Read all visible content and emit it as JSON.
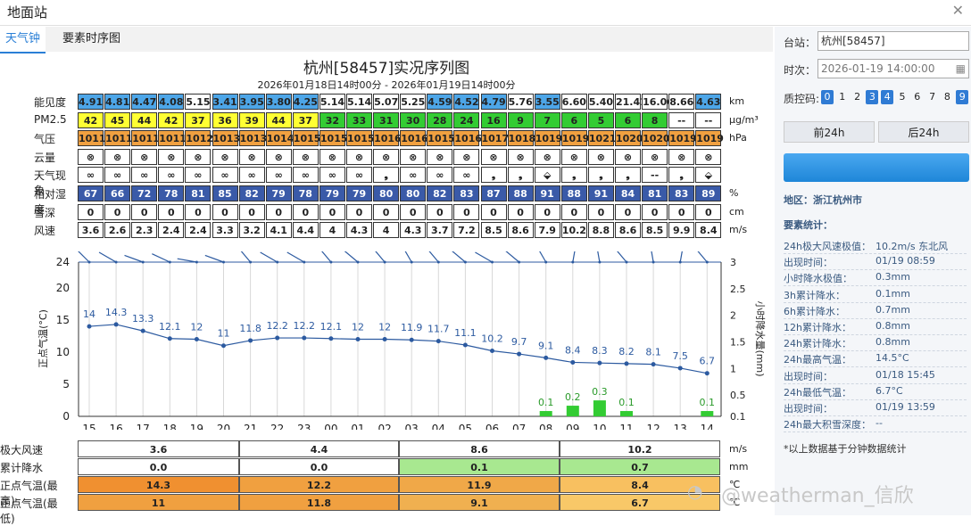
{
  "window": {
    "title": "地面站",
    "close_icon": "close-icon"
  },
  "tabs": [
    {
      "label": "天气钟",
      "active": true
    },
    {
      "label": "要素时序图",
      "active": false
    }
  ],
  "chart": {
    "title": "杭州[58457]实况序列图",
    "subtitle": "2026年01月18日14时00分 - 2026年01月19日14时00分"
  },
  "hours": [
    "15",
    "16",
    "17",
    "18",
    "19",
    "20",
    "21",
    "22",
    "23",
    "00",
    "01",
    "02",
    "03",
    "04",
    "05",
    "06",
    "07",
    "08",
    "09",
    "10",
    "11",
    "12",
    "13",
    "14"
  ],
  "rows": [
    {
      "label": "能见度",
      "unit": "km",
      "values": [
        "4.91",
        "4.81",
        "4.47",
        "4.08",
        "5.15",
        "3.41",
        "3.95",
        "3.80",
        "4.25",
        "5.14",
        "5.14",
        "5.07",
        "5.25",
        "4.59",
        "4.52",
        "4.79",
        "5.76",
        "3.55",
        "6.60",
        "5.40",
        "21.41",
        "16.06",
        "8.66",
        "4.63"
      ],
      "colors": [
        "#4da6e8",
        "#4da6e8",
        "#4da6e8",
        "#4da6e8",
        "#ffffff",
        "#4da6e8",
        "#4da6e8",
        "#4da6e8",
        "#4da6e8",
        "#ffffff",
        "#ffffff",
        "#ffffff",
        "#ffffff",
        "#4da6e8",
        "#4da6e8",
        "#4da6e8",
        "#ffffff",
        "#4da6e8",
        "#ffffff",
        "#ffffff",
        "#ffffff",
        "#ffffff",
        "#ffffff",
        "#4da6e8"
      ]
    },
    {
      "label": "PM2.5",
      "unit": "μg/m³",
      "values": [
        "42",
        "45",
        "44",
        "42",
        "37",
        "36",
        "39",
        "44",
        "37",
        "32",
        "33",
        "31",
        "30",
        "28",
        "24",
        "16",
        "9",
        "7",
        "6",
        "5",
        "6",
        "8",
        "--",
        "--"
      ],
      "colors": [
        "#ffff33",
        "#ffff33",
        "#ffff33",
        "#ffff33",
        "#ffff33",
        "#ffff33",
        "#ffff33",
        "#ffff33",
        "#ffff33",
        "#33cc33",
        "#33cc33",
        "#33cc33",
        "#33cc33",
        "#33cc33",
        "#33cc33",
        "#33cc33",
        "#33cc33",
        "#33cc33",
        "#33cc33",
        "#33cc33",
        "#33cc33",
        "#33cc33",
        "#ffffff",
        "#ffffff"
      ]
    },
    {
      "label": "气压",
      "unit": "hPa",
      "values": [
        "1011",
        "1011",
        "1011",
        "1011",
        "1012",
        "1013",
        "1013",
        "1014",
        "1015",
        "1015",
        "1015",
        "1016",
        "1016",
        "1015",
        "1016",
        "1017",
        "1018",
        "1019",
        "1019",
        "1021",
        "1020",
        "1020",
        "1019",
        "1019"
      ],
      "colors": [
        "#f0a040",
        "#f0a040",
        "#f0a040",
        "#f0a040",
        "#f0a040",
        "#f0a040",
        "#f0a040",
        "#f0a040",
        "#f0a040",
        "#f0a040",
        "#f0a040",
        "#f0a040",
        "#f0a040",
        "#f0a040",
        "#f0a040",
        "#f0a040",
        "#f0a040",
        "#f0a040",
        "#f0a040",
        "#f0a040",
        "#f0a040",
        "#f0a040",
        "#f0a040",
        "#f0a040"
      ]
    },
    {
      "label": "云量",
      "unit": "",
      "values": [
        "⊗",
        "⊗",
        "⊗",
        "⊗",
        "⊗",
        "⊗",
        "⊗",
        "⊗",
        "⊗",
        "⊗",
        "⊗",
        "⊗",
        "⊗",
        "⊗",
        "⊗",
        "⊗",
        "⊗",
        "⊗",
        "⊗",
        "⊗",
        "⊗",
        "⊗",
        "⊗",
        "⊗"
      ],
      "colors": []
    },
    {
      "label": "天气现象",
      "unit": "",
      "values": [
        "∞",
        "∞",
        "∞",
        "∞",
        "∞",
        "∞",
        "∞",
        "∞",
        "∞",
        "∞",
        "∞",
        "❟",
        "∞",
        "∞",
        "∞",
        "❟",
        "❟",
        "⬙",
        "❟",
        "❟",
        "❟",
        "--",
        "❟",
        "⬙"
      ],
      "colors": []
    },
    {
      "label": "相对湿度",
      "unit": "%",
      "values": [
        "67",
        "66",
        "72",
        "78",
        "81",
        "85",
        "82",
        "79",
        "78",
        "79",
        "79",
        "80",
        "80",
        "82",
        "83",
        "87",
        "88",
        "91",
        "88",
        "91",
        "84",
        "81",
        "83",
        "89"
      ],
      "colors": [
        "#3a5aa8",
        "#3a5aa8",
        "#3a5aa8",
        "#3a5aa8",
        "#3a5aa8",
        "#3a5aa8",
        "#3a5aa8",
        "#3a5aa8",
        "#3a5aa8",
        "#3a5aa8",
        "#3a5aa8",
        "#3a5aa8",
        "#3a5aa8",
        "#3a5aa8",
        "#3a5aa8",
        "#3a5aa8",
        "#3a5aa8",
        "#3a5aa8",
        "#3a5aa8",
        "#3a5aa8",
        "#3a5aa8",
        "#3a5aa8",
        "#3a5aa8",
        "#3a5aa8"
      ]
    },
    {
      "label": "雪深",
      "unit": "cm",
      "values": [
        "0",
        "0",
        "0",
        "0",
        "0",
        "0",
        "0",
        "0",
        "0",
        "0",
        "0",
        "0",
        "0",
        "0",
        "0",
        "0",
        "0",
        "0",
        "0",
        "0",
        "0",
        "0",
        "0",
        "0"
      ],
      "colors": []
    },
    {
      "label": "风速",
      "unit": "m/s",
      "values": [
        "3.6",
        "2.6",
        "2.3",
        "2.4",
        "2.4",
        "3.3",
        "3.2",
        "4.1",
        "4.4",
        "4",
        "4.3",
        "4",
        "4.3",
        "3.7",
        "7.2",
        "8.5",
        "8.6",
        "7.9",
        "10.2",
        "8.8",
        "8.6",
        "8.5",
        "9.9",
        "8.4"
      ],
      "colors": []
    }
  ],
  "chart_data": {
    "type": "line",
    "x": [
      "15",
      "16",
      "17",
      "18",
      "19",
      "20",
      "21",
      "22",
      "23",
      "00",
      "01",
      "02",
      "03",
      "04",
      "05",
      "06",
      "07",
      "08",
      "09",
      "10",
      "11",
      "12",
      "13",
      "14"
    ],
    "series": [
      {
        "values": [
          14,
          14.3,
          13.3,
          12.1,
          12,
          11,
          11.8,
          12.2,
          12.2,
          12.1,
          12,
          12,
          11.9,
          11.7,
          11.1,
          10.2,
          9.7,
          9.1,
          8.4,
          8.3,
          8.2,
          8.1,
          7.5,
          6.7
        ],
        "color": "#2c5aa0"
      },
      {
        "type": "bar",
        "values": [
          null,
          null,
          null,
          null,
          null,
          null,
          null,
          null,
          null,
          null,
          null,
          null,
          null,
          null,
          null,
          null,
          null,
          0.1,
          0.2,
          0.3,
          0.1,
          null,
          null,
          0.1
        ],
        "color": "#33cc33"
      }
    ],
    "ylabel": "正点气温(°C)",
    "y2label": "小时降水量(mm)",
    "ylim": [
      0,
      24
    ],
    "y2lim": [
      0.1,
      3
    ],
    "yticks": [
      "0",
      "5",
      "10",
      "15",
      "20",
      "24"
    ],
    "y2ticks": [
      "0.1",
      "0.5",
      "1",
      "1.5",
      "2",
      "2.5",
      "3"
    ],
    "wind_dir_deg": [
      315,
      300,
      290,
      295,
      280,
      290,
      320,
      300,
      300,
      320,
      310,
      320,
      330,
      320,
      310,
      300,
      310,
      330,
      10,
      350,
      320,
      350,
      10,
      320
    ]
  },
  "bottom": {
    "rows": [
      {
        "label": "极大风速",
        "unit": "m/s",
        "values": [
          "3.6",
          "4.4",
          "8.6",
          "10.2"
        ],
        "colors": [
          "#ffffff",
          "#ffffff",
          "#ffffff",
          "#ffffff"
        ]
      },
      {
        "label": "累计降水",
        "unit": "mm",
        "values": [
          "0.0",
          "0.0",
          "0.1",
          "0.7"
        ],
        "colors": [
          "#ffffff",
          "#ffffff",
          "#a8e890",
          "#a8e890"
        ]
      },
      {
        "label": "正点气温(最高)",
        "unit": "℃",
        "values": [
          "14.3",
          "12.2",
          "11.9",
          "8.4"
        ],
        "colors": [
          "#f09030",
          "#f0a040",
          "#f0a848",
          "#f8c060"
        ]
      },
      {
        "label": "正点气温(最低)",
        "unit": "℃",
        "values": [
          "11",
          "11.8",
          "9.1",
          "6.7"
        ],
        "colors": [
          "#f0a040",
          "#f0a040",
          "#f0b050",
          "#f8c868"
        ]
      }
    ],
    "watermark": "@weatherman_信欣"
  },
  "side": {
    "station_label": "台站：",
    "station_value": "杭州[58457]",
    "time_label": "时次：",
    "time_value": "2026-01-19 14:00:00",
    "qc_label": "质控码:",
    "qc_codes": [
      "0",
      "1",
      "2",
      "3",
      "4",
      "5",
      "6",
      "7",
      "8",
      "9"
    ],
    "qc_on": [
      true,
      false,
      false,
      true,
      true,
      false,
      false,
      false,
      false,
      true
    ],
    "prev_btn": "前24h",
    "next_btn": "后24h",
    "region": "地区：浙江杭州市",
    "stats_title": "要素统计：",
    "stats": [
      {
        "k": "24h极大风速极值：",
        "v": "10.2m/s 东北风"
      },
      {
        "k": "出现时间：",
        "v": "01/19 08:59"
      },
      {
        "k": "小时降水极值：",
        "v": "0.3mm"
      },
      {
        "k": "3h累计降水：",
        "v": "0.1mm"
      },
      {
        "k": "6h累计降水：",
        "v": "0.7mm"
      },
      {
        "k": "12h累计降水：",
        "v": "0.8mm"
      },
      {
        "k": "24h累计降水：",
        "v": "0.8mm"
      },
      {
        "k": "24h最高气温：",
        "v": "14.5°C"
      },
      {
        "k": "出现时间：",
        "v": "01/18 15:45"
      },
      {
        "k": "24h最低气温：",
        "v": "6.7°C"
      },
      {
        "k": "出现时间：",
        "v": "01/19 13:59"
      },
      {
        "k": "24h最大积雪深度：",
        "v": "--"
      }
    ],
    "footnote": "*以上数据基于分钟数据统计"
  }
}
